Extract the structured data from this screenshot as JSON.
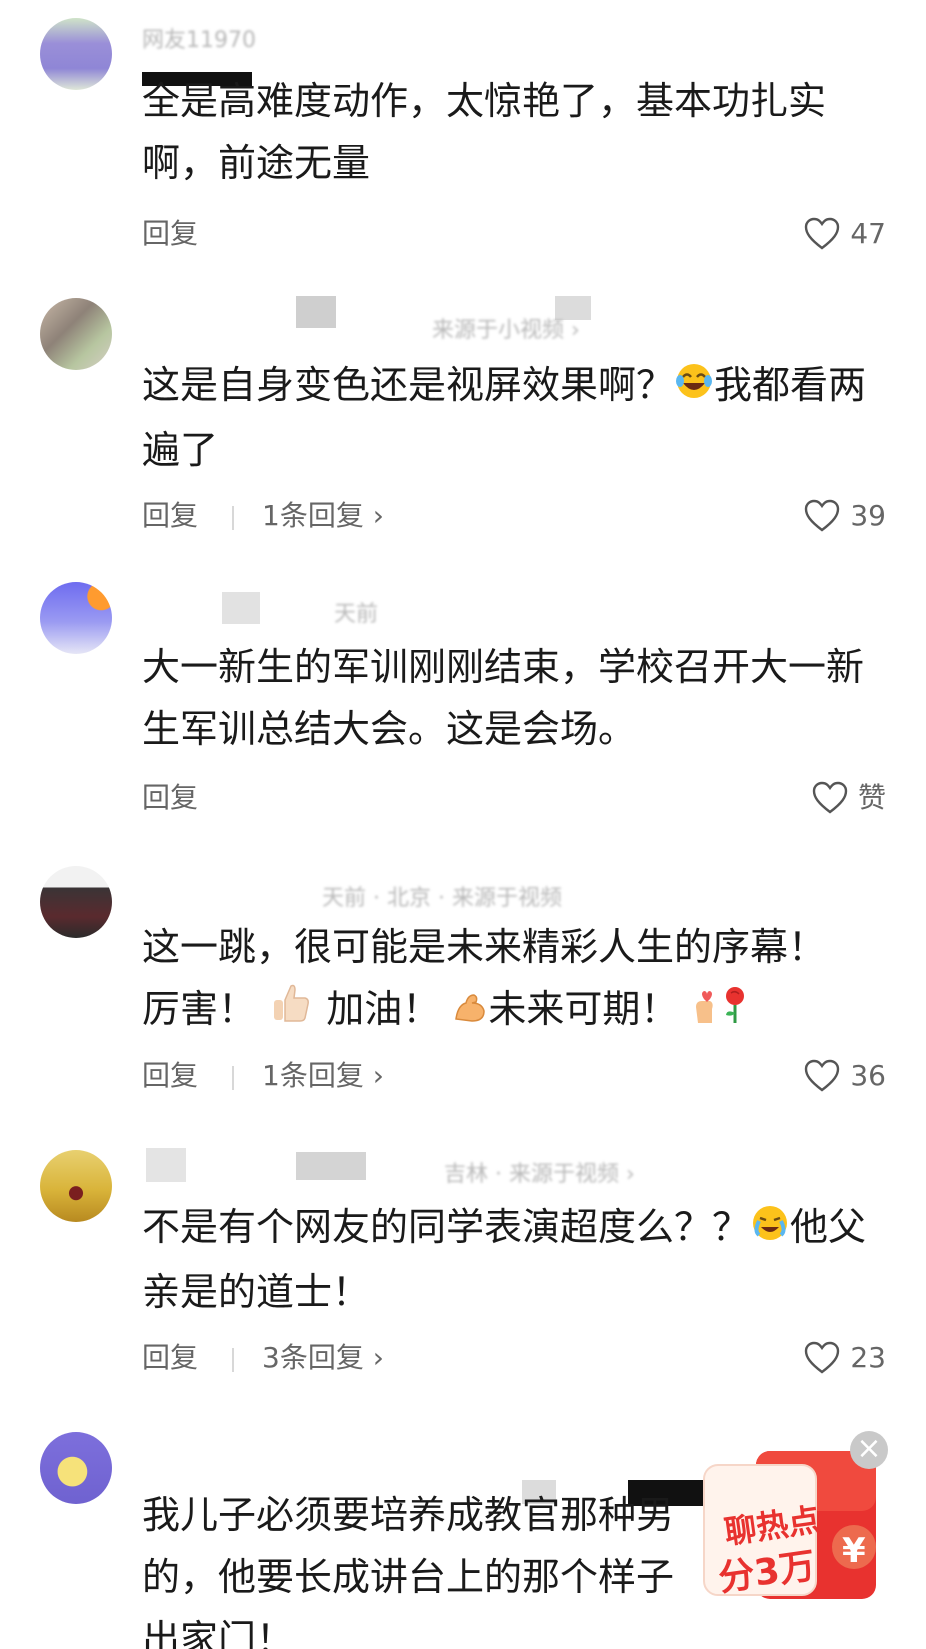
{
  "reply_label": "回复",
  "comments": [
    {
      "meta": "网友11970",
      "text": "全是高难度动作，太惊艳了，基本功扎实啊，前途无量",
      "reply_count": "",
      "likes": "47"
    },
    {
      "meta": "来源于小视频 ›",
      "text_a": "这是自身变色还是视屏效果啊？",
      "text_b": "我都看两遍了",
      "reply_count": "1条回复 ›",
      "likes": "39"
    },
    {
      "meta": "天前",
      "text": "大一新生的军训刚刚结束，学校召开大一新生军训总结大会。这是会场。",
      "reply_count": "",
      "likes": "赞"
    },
    {
      "meta": "天前 · 北京 · 来源于视频",
      "text_a": "这一跳，很可能是未来精彩人生的序幕！",
      "text_b": "厉害！",
      "text_c": "加油！",
      "text_d": "未来可期！",
      "reply_count": "1条回复 ›",
      "likes": "36"
    },
    {
      "meta": "吉林 · 来源于视频 ›",
      "text_a": "不是有个网友的同学表演超度么？？",
      "text_b": "他父亲是的道士！",
      "reply_count": "3条回复 ›",
      "likes": "23"
    },
    {
      "meta": "",
      "text": "我儿子必须要培养成教官那种男的，他要长成讲台上的那个样子出家门！",
      "reply_count": "",
      "likes": ""
    }
  ],
  "promo": {
    "line1": "聊热点",
    "line2": "分3万",
    "symbol": "¥",
    "close": "×"
  },
  "colors": {
    "text": "#1a1a1a",
    "secondary": "#666666",
    "promo_red": "#e8322f"
  },
  "icons": [
    "heart-icon",
    "chevron-right-icon",
    "laughing-emoji",
    "thumbs-up-emoji",
    "flexed-biceps-emoji",
    "finger-heart-emoji",
    "rose-emoji",
    "crying-laughing-emoji",
    "close-icon"
  ]
}
